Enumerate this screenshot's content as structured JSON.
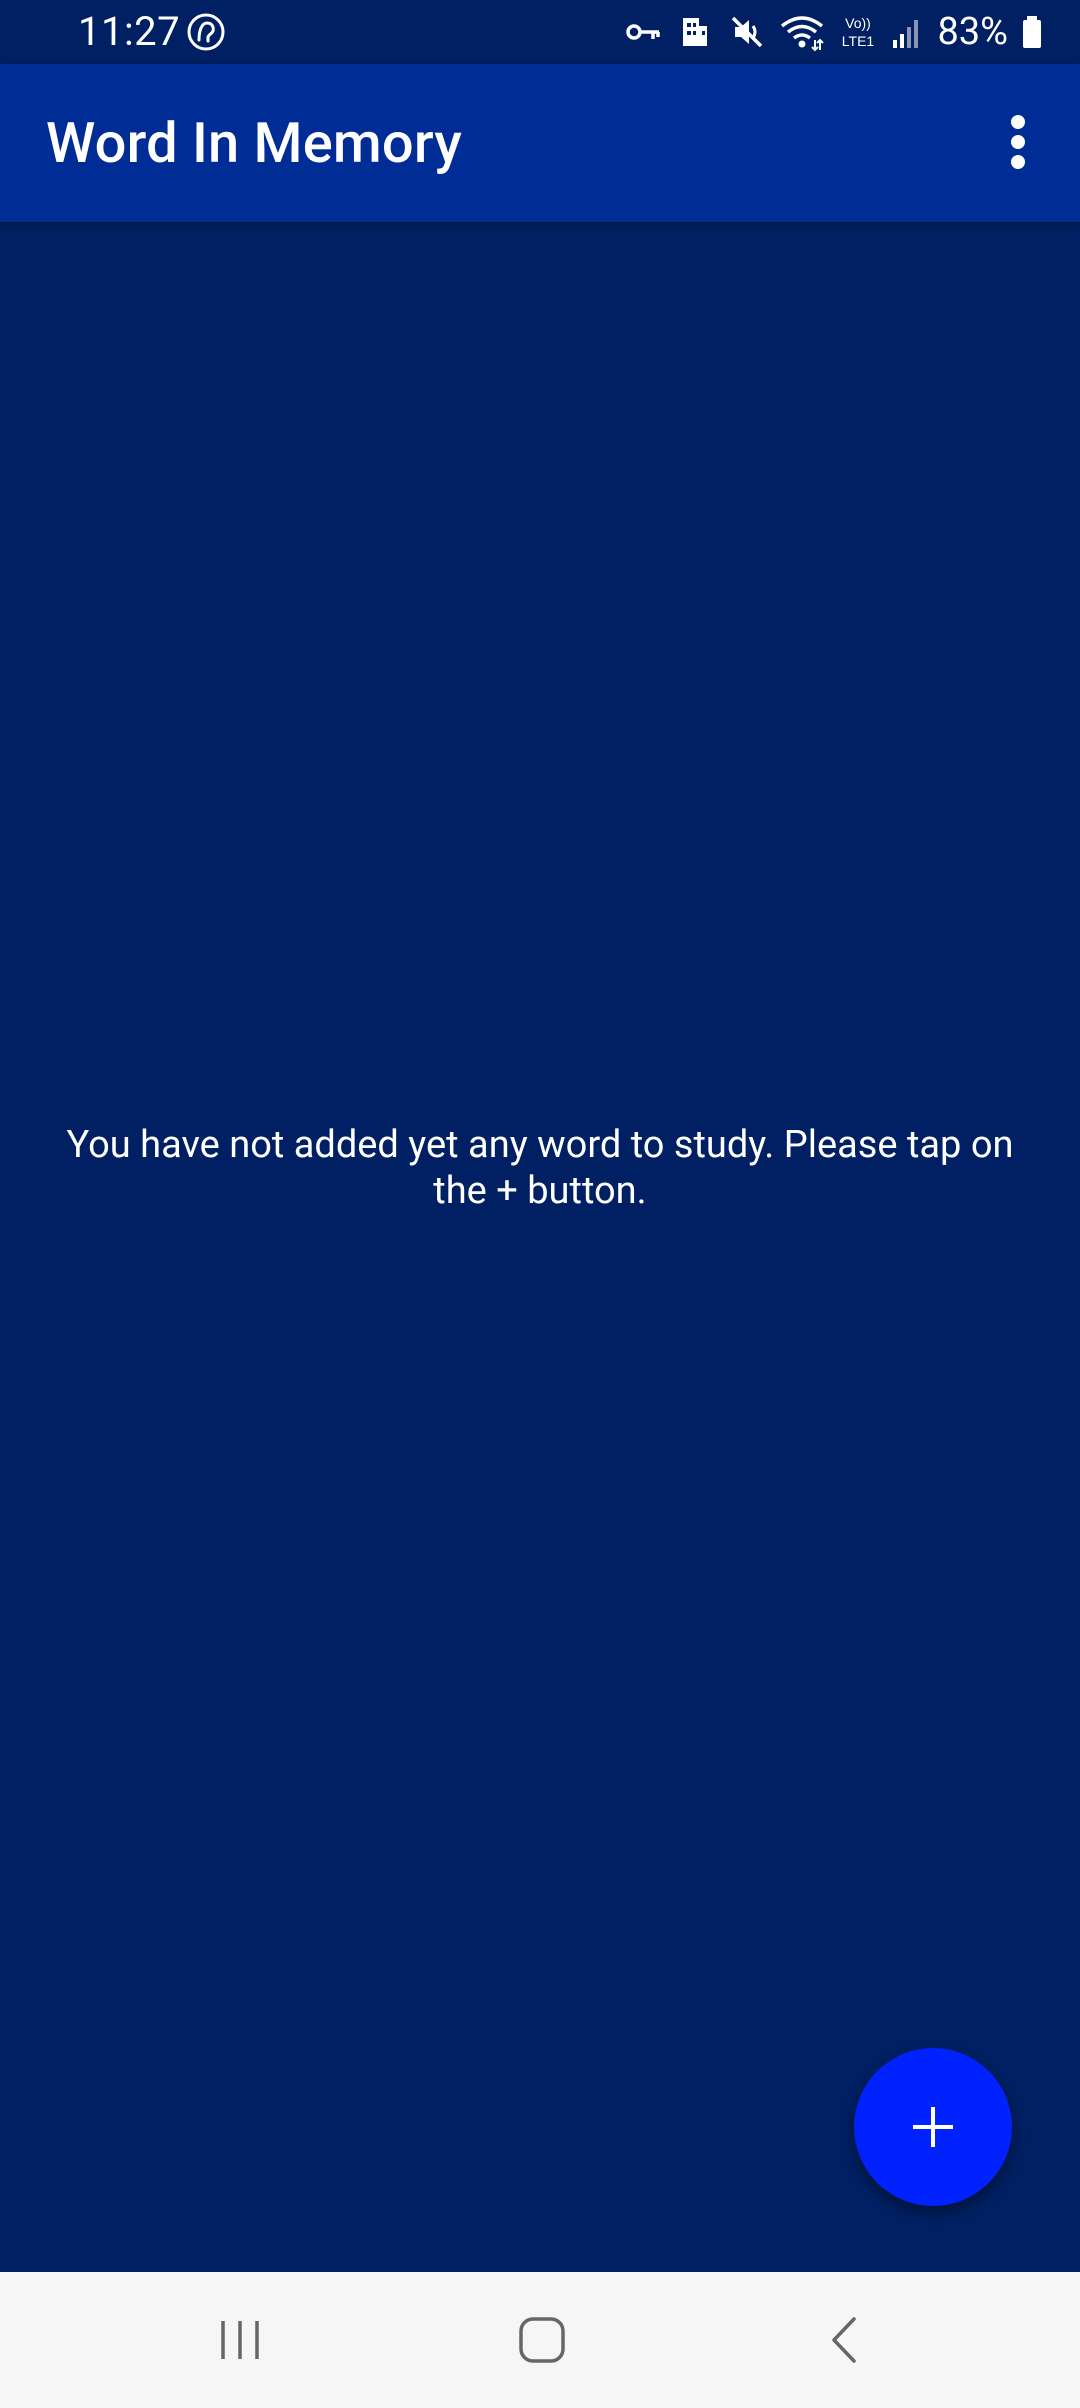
{
  "status_bar": {
    "time": "11:27",
    "battery_percent": "83%",
    "icons": [
      "app-notification-icon",
      "vpn-key-icon",
      "work-profile-icon",
      "mute-icon",
      "wifi-icon",
      "volte-icon",
      "signal-icon",
      "battery-icon"
    ]
  },
  "app_bar": {
    "title": "Word In Memory",
    "overflow_icon": "more-vert-icon"
  },
  "main": {
    "empty_message": "You have not added yet any word to study. Please tap on the + button."
  },
  "fab": {
    "icon": "plus-icon"
  },
  "nav_bar": {
    "buttons": [
      "recents-icon",
      "home-icon",
      "back-icon"
    ]
  },
  "colors": {
    "background": "#002063",
    "app_bar": "#002C96",
    "fab": "#0022FF",
    "nav_bar": "#F6F6F6",
    "text": "#FFFFFF"
  }
}
